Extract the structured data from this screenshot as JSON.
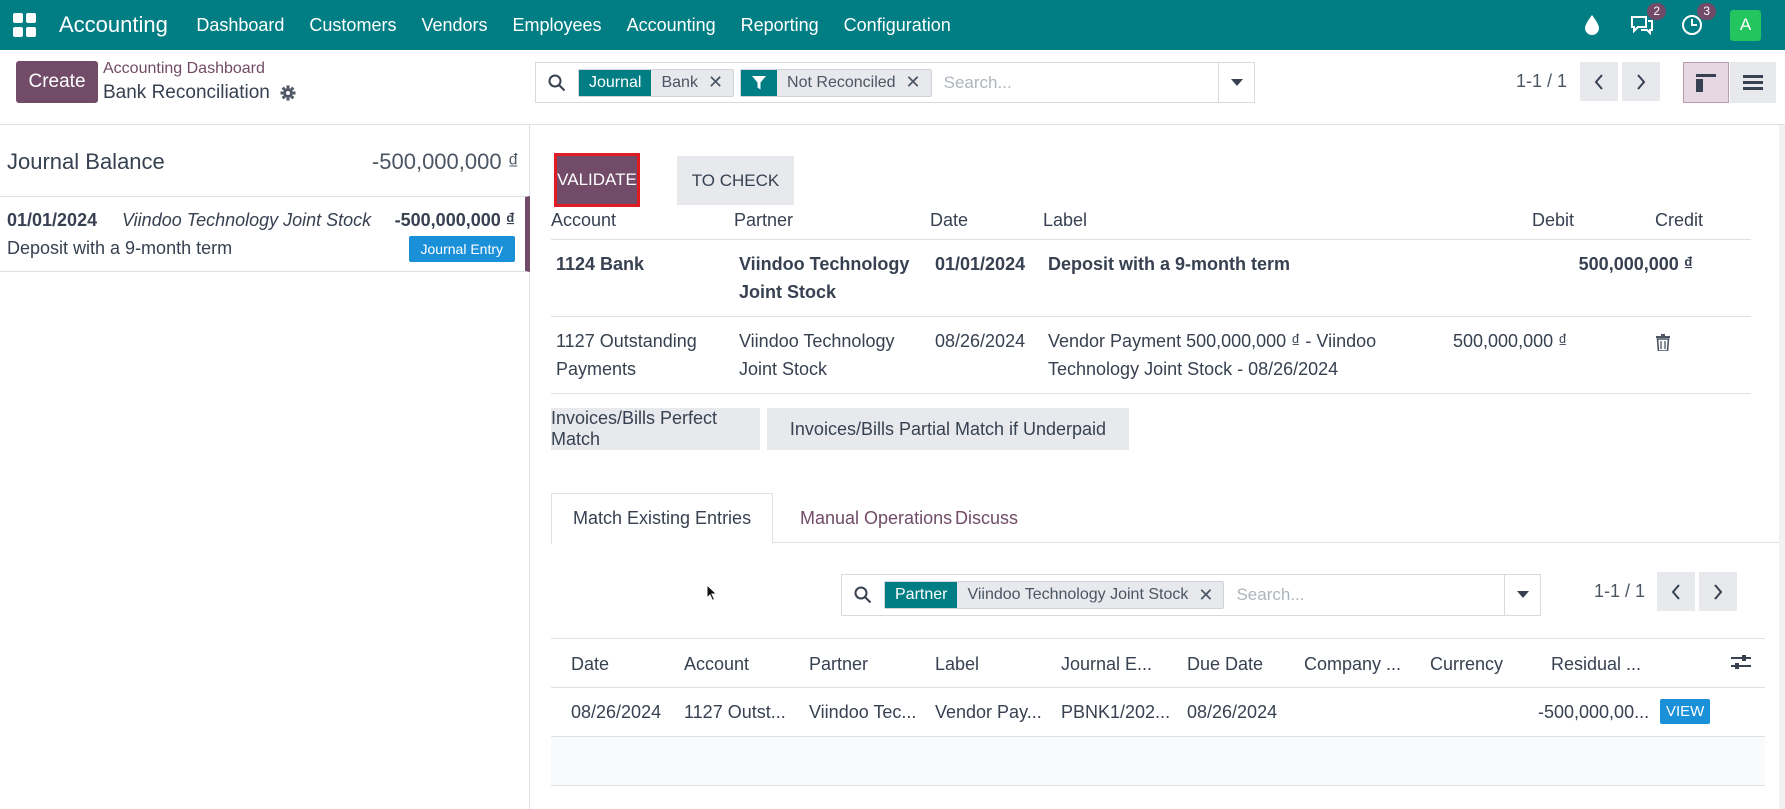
{
  "navbar": {
    "brand": "Accounting",
    "menu": [
      "Dashboard",
      "Customers",
      "Vendors",
      "Employees",
      "Accounting",
      "Reporting",
      "Configuration"
    ],
    "messages_count": "2",
    "activities_count": "3",
    "avatar_letter": "A",
    "bg_color": "#017e84"
  },
  "control_panel": {
    "create_label": "Create",
    "breadcrumb_parent": "Accounting Dashboard",
    "breadcrumb_current": "Bank Reconciliation",
    "search": {
      "facets": [
        {
          "label": "Journal",
          "value": "Bank"
        },
        {
          "label": "",
          "value": "Not Reconciled"
        }
      ],
      "placeholder": "Search..."
    },
    "pager": "1-1 / 1"
  },
  "left_panel": {
    "title": "Journal Balance",
    "balance": "-500,000,000 ₫",
    "statement_line": {
      "date": "01/01/2024",
      "partner": "Viindoo Technology Joint Stock",
      "amount": "-500,000,000 ₫",
      "label": "Deposit with a 9-month term",
      "badge": "Journal Entry"
    }
  },
  "right_panel": {
    "validate_label": "VALIDATE",
    "to_check_label": "TO CHECK",
    "lines_headers": {
      "account": "Account",
      "partner": "Partner",
      "date": "Date",
      "label": "Label",
      "debit": "Debit",
      "credit": "Credit"
    },
    "lines": [
      {
        "account": "1124 Bank",
        "partner_l1": "Viindoo Technology",
        "partner_l2": "Joint Stock",
        "date": "01/01/2024",
        "label_l1": "Deposit with a 9-month term",
        "label_l2": "",
        "debit": "",
        "credit": "500,000,000 ₫"
      },
      {
        "account_l1": "1127 Outstanding",
        "account_l2": "Payments",
        "partner_l1": "Viindoo Technology",
        "partner_l2": "Joint Stock",
        "date": "08/26/2024",
        "label_l1": "Vendor Payment 500,000,000 ₫ - Viindoo",
        "label_l2": "Technology Joint Stock - 08/26/2024",
        "debit": "500,000,000 ₫",
        "credit": ""
      }
    ],
    "match_buttons": [
      "Invoices/Bills Perfect Match",
      "Invoices/Bills Partial Match if Underpaid"
    ],
    "tabs": [
      "Match Existing Entries",
      "Manual Operations",
      "Discuss"
    ],
    "sub_search": {
      "facet_label": "Partner",
      "facet_value": "Viindoo Technology Joint Stock",
      "placeholder": "Search...",
      "pager": "1-1 / 1"
    },
    "amls_headers": [
      "Date",
      "Account",
      "Partner",
      "Label",
      "Journal E...",
      "Due Date",
      "Company ...",
      "Currency",
      "Residual ..."
    ],
    "amls_rows": [
      {
        "date": "08/26/2024",
        "account": "1127 Outst...",
        "partner": "Viindoo Tec...",
        "label": "Vendor Pay...",
        "journal_entry": "PBNK1/202...",
        "due_date": "08/26/2024",
        "company": "",
        "currency": "",
        "residual": "-500,000,00...",
        "view_label": "VIEW"
      }
    ]
  },
  "colors": {
    "primary": "#714b67",
    "teal": "#017e84",
    "highlight": "#e01b24",
    "info_blue": "#1a90d8"
  }
}
